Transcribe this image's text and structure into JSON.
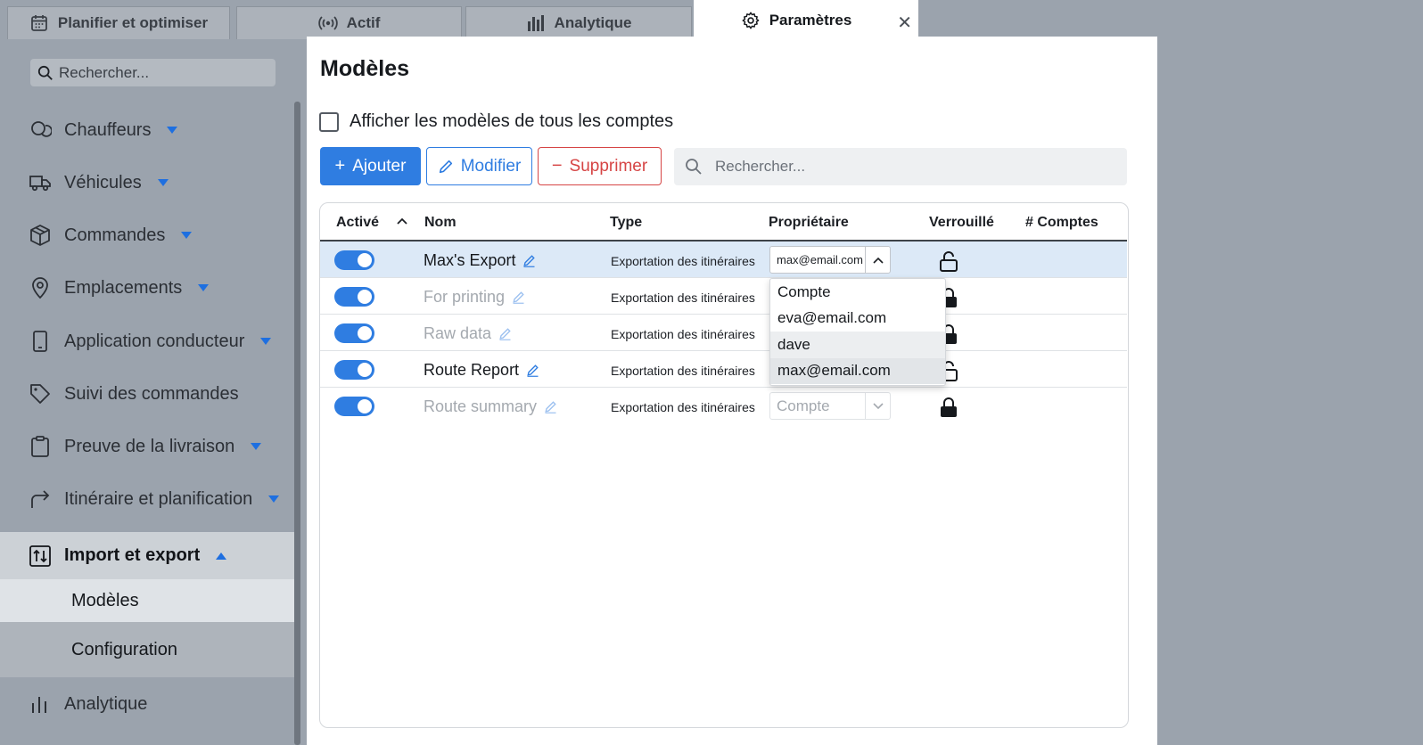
{
  "tabs": [
    {
      "label": "Planifier et optimiser",
      "icon": "calendar-icon"
    },
    {
      "label": "Actif",
      "icon": "broadcast-icon"
    },
    {
      "label": "Analytique",
      "icon": "bar-chart-icon"
    },
    {
      "label": "Paramètres",
      "icon": "gear-icon",
      "active": true
    }
  ],
  "sidebar": {
    "search_placeholder": "Rechercher...",
    "items": [
      {
        "label": "Chauffeurs",
        "icon": "chat-bubbles-icon"
      },
      {
        "label": "Véhicules",
        "icon": "truck-icon"
      },
      {
        "label": "Commandes",
        "icon": "package-icon"
      },
      {
        "label": "Emplacements",
        "icon": "map-pin-icon"
      },
      {
        "label": "Application conducteur",
        "icon": "phone-icon"
      },
      {
        "label": "Suivi des commandes",
        "icon": "tag-icon"
      },
      {
        "label": "Preuve de la livraison",
        "icon": "clipboard-icon"
      },
      {
        "label": "Itinéraire et planification",
        "icon": "route-arrow-icon"
      },
      {
        "label": "Import et export",
        "icon": "import-export-icon"
      }
    ],
    "subitems": [
      "Modèles",
      "Configuration"
    ],
    "bottom_item": {
      "label": "Analytique",
      "icon": "bar-chart-icon"
    }
  },
  "panel": {
    "title": "Modèles",
    "checkbox_label": "Afficher les modèles de tous les comptes",
    "buttons": {
      "add": "Ajouter",
      "edit": "Modifier",
      "delete": "Supprimer"
    },
    "search_placeholder": "Rechercher..."
  },
  "table": {
    "columns": [
      "Activé",
      "Nom",
      "Type",
      "Propriétaire",
      "Verrouillé",
      "# Comptes"
    ],
    "rows": [
      {
        "active": true,
        "name": "Max's Export",
        "type": "Exportation des itinéraires",
        "owner": "max@email.com",
        "locked": false
      },
      {
        "active": true,
        "name": "For printing",
        "type": "Exportation des itinéraires",
        "owner": "",
        "locked": true
      },
      {
        "active": true,
        "name": "Raw data",
        "type": "Exportation des itinéraires",
        "owner": "",
        "locked": true
      },
      {
        "active": true,
        "name": "Route Report",
        "type": "Exportation des itinéraires",
        "owner": "",
        "locked": false
      },
      {
        "active": true,
        "name": "Route summary",
        "type": "Exportation des itinéraires",
        "owner_placeholder": "Compte",
        "locked": true
      }
    ]
  },
  "owner_dropdown": {
    "options": [
      "Compte",
      "eva@email.com",
      "dave",
      "max@email.com"
    ],
    "selected": "max@email.com"
  },
  "colors": {
    "accent": "#2f7de1",
    "danger": "#d64545"
  }
}
